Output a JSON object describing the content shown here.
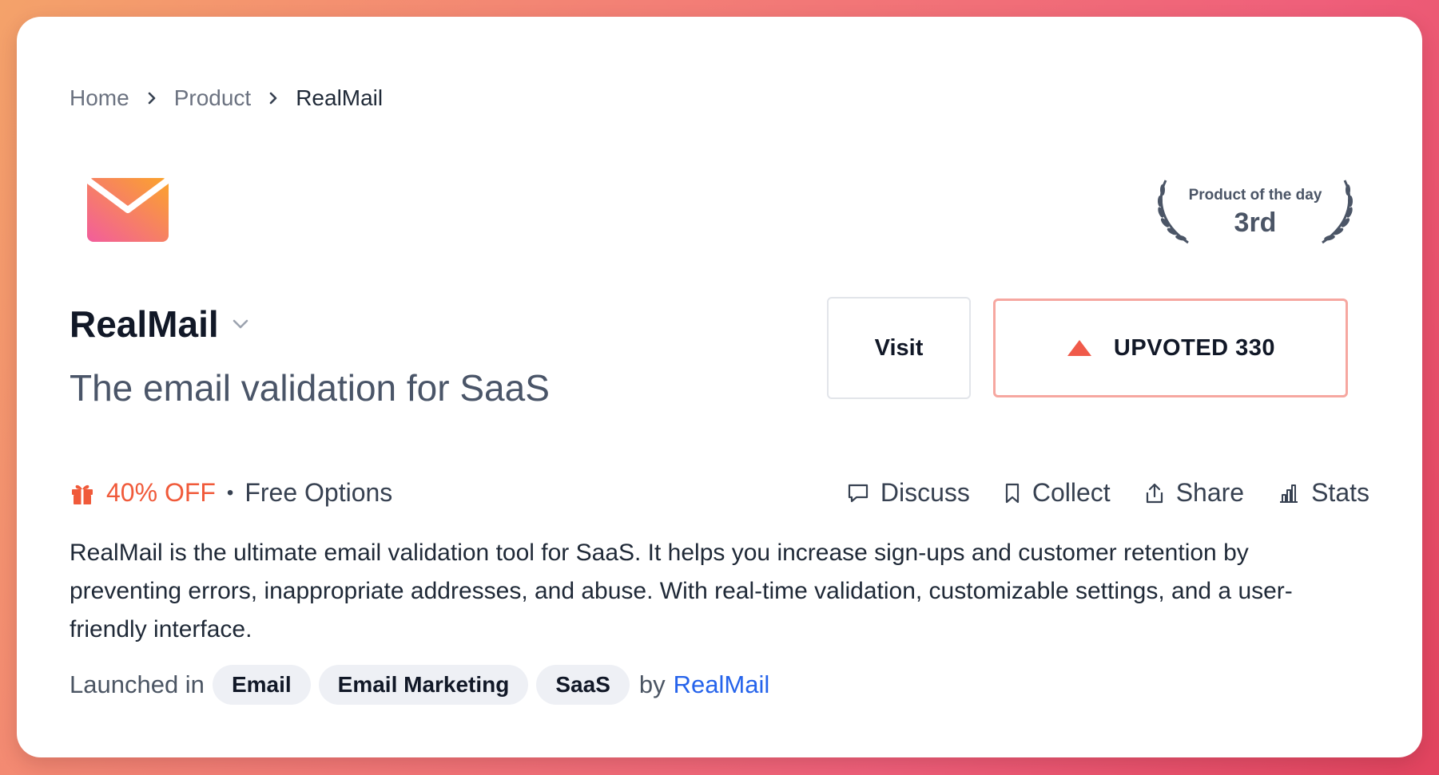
{
  "breadcrumb": {
    "items": [
      "Home",
      "Product",
      "RealMail"
    ]
  },
  "product": {
    "name": "RealMail",
    "tagline": "The email validation for SaaS",
    "logo_icon": "envelope-icon"
  },
  "badge": {
    "label": "Product of the day",
    "rank": "3rd"
  },
  "buttons": {
    "visit": "Visit",
    "upvote": "UPVOTED 330"
  },
  "offer": {
    "discount": "40% OFF",
    "separator": "•",
    "free_options": "Free Options"
  },
  "actions": [
    {
      "label": "Discuss",
      "icon": "comment-icon"
    },
    {
      "label": "Collect",
      "icon": "bookmark-icon"
    },
    {
      "label": "Share",
      "icon": "share-icon"
    },
    {
      "label": "Stats",
      "icon": "bar-chart-icon"
    }
  ],
  "description": "RealMail is the ultimate email validation tool for SaaS. It helps you increase sign-ups and customer retention by preventing errors, inappropriate addresses, and abuse. With real-time validation, customizable settings, and a user-friendly interface.",
  "launch": {
    "prefix": "Launched in",
    "tags": [
      "Email",
      "Email Marketing",
      "SaaS"
    ],
    "by": "by",
    "maker": "RealMail"
  },
  "colors": {
    "accent": "#f05a3a",
    "upvote_border": "#f6a7a0",
    "link": "#2563eb"
  }
}
